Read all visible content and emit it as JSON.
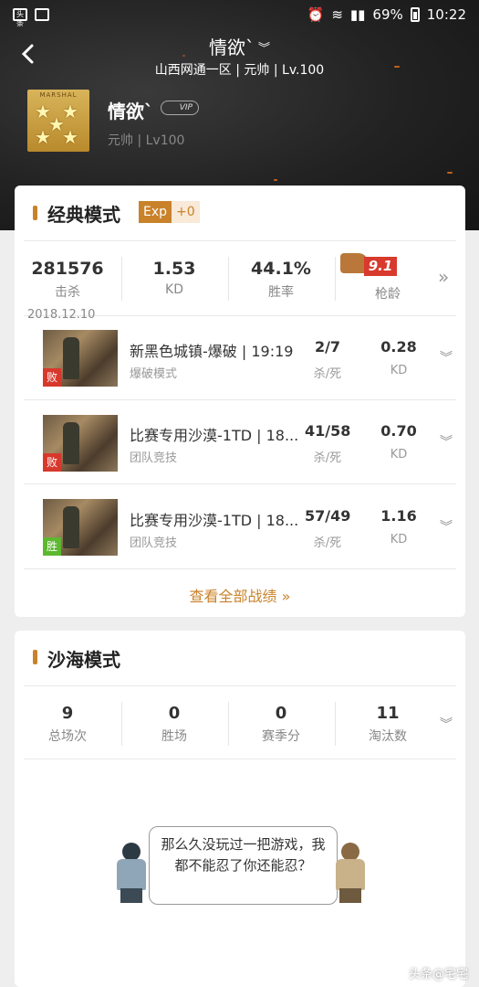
{
  "status_bar": {
    "battery": "69%",
    "time": "10:22",
    "app_icon": "头条"
  },
  "nav": {
    "title": "情欲`",
    "subtitle": "山西网通一区 | 元帅 | Lv.100"
  },
  "profile": {
    "name": "情欲`",
    "rank_badge_label": "MARSHAL",
    "vip_label": "VIP",
    "sub": "元帅 | Lv100"
  },
  "classic": {
    "title": "经典模式",
    "exp_key": "Exp",
    "exp_value": "+0",
    "stats": [
      {
        "value": "281576",
        "label": "击杀"
      },
      {
        "value": "1.53",
        "label": "KD"
      },
      {
        "value": "44.1%",
        "label": "胜率"
      },
      {
        "value": "9.1",
        "label": "枪龄"
      }
    ],
    "date": "2018.12.10",
    "matches": [
      {
        "map": "新黑色城镇-爆破 | 19:19",
        "mode": "爆破模式",
        "result": "败",
        "result_color": "#d8382c",
        "kills": "2/7",
        "kills_label": "杀/死",
        "kd": "0.28",
        "kd_label": "KD"
      },
      {
        "map": "比赛专用沙漠-1TD | 18...",
        "mode": "团队竞技",
        "result": "败",
        "result_color": "#d8382c",
        "kills": "41/58",
        "kills_label": "杀/死",
        "kd": "0.70",
        "kd_label": "KD"
      },
      {
        "map": "比赛专用沙漠-1TD | 18...",
        "mode": "团队竞技",
        "result": "胜",
        "result_color": "#5cb82f",
        "kills": "57/49",
        "kills_label": "杀/死",
        "kd": "1.16",
        "kd_label": "KD"
      }
    ],
    "view_all": "查看全部战绩 »"
  },
  "desert": {
    "title": "沙海模式",
    "stats": [
      {
        "value": "9",
        "label": "总场次"
      },
      {
        "value": "0",
        "label": "胜场"
      },
      {
        "value": "0",
        "label": "赛季分"
      },
      {
        "value": "11",
        "label": "淘汰数"
      }
    ],
    "bubble": "那么久没玩过一把游戏，我都不能忍了你还能忍？"
  },
  "watermark": "头条@宅宅"
}
